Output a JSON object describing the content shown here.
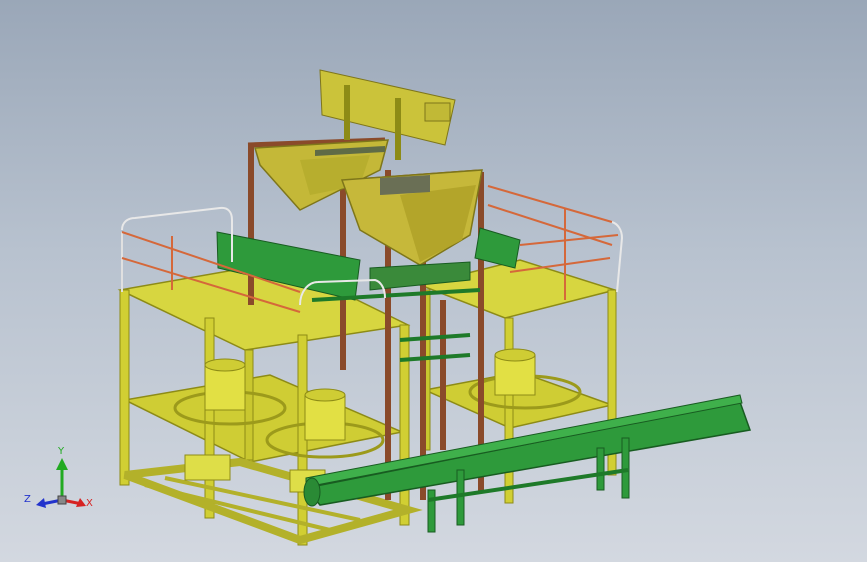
{
  "view": {
    "background_top": "#9aa7b8",
    "background_bottom": "#d3d8e0"
  },
  "colors": {
    "frame_yellow": "#d7d640",
    "frame_yellow_dark": "#9c9a1b",
    "hopper_yellow": "#cfc33a",
    "conveyor_green": "#2e9a3b",
    "conveyor_green_dark": "#1c6c25",
    "support_brown": "#8a4a2a",
    "rail_orange": "#d5683a",
    "rail_white": "#e8e8e8",
    "axis_x": "#d62222",
    "axis_y": "#22aa22",
    "axis_z": "#2233cc"
  },
  "triad": {
    "x_label": "X",
    "y_label": "Y",
    "z_label": "Z"
  }
}
